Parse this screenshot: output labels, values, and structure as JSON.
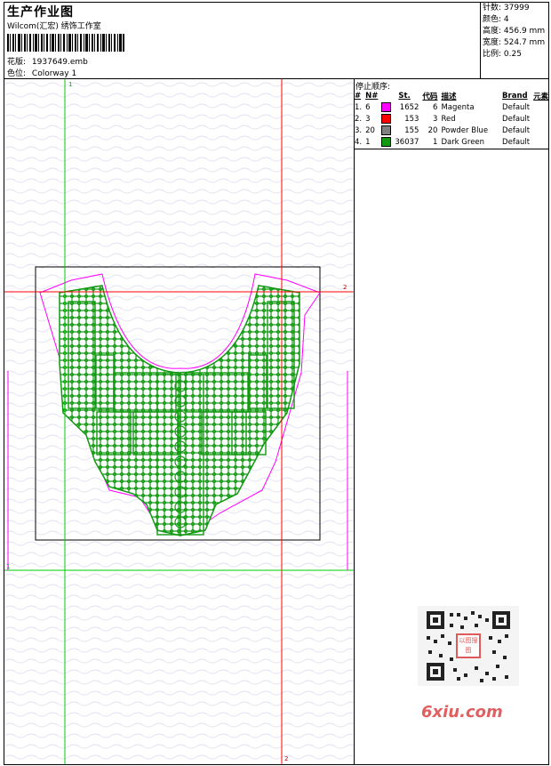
{
  "header": {
    "title": "生产作业图",
    "company": "Wilcom(汇宏) 绣饰工作室",
    "design_label": "花版:",
    "design_value": "1937649.emb",
    "colorway_label": "色位:",
    "colorway_value": "Colorway 1"
  },
  "stats": {
    "stitches_label": "针数:",
    "stitches_value": "37999",
    "colors_label": "颜色:",
    "colors_value": "4",
    "height_label": "高度:",
    "height_value": "456.9 mm",
    "width_label": "宽度:",
    "width_value": "524.7 mm",
    "scale_label": "比例:",
    "scale_value": "0.25"
  },
  "stop_sequence": {
    "title": "停止顺序:",
    "columns": [
      "#",
      "N#",
      "St.",
      "代码",
      "描述",
      "Brand",
      "元素"
    ],
    "rows": [
      {
        "index": "1.",
        "needle": "6",
        "color": "#ff00ff",
        "stitches": "1652",
        "code": "6",
        "desc": "Magenta",
        "brand": "Default"
      },
      {
        "index": "2.",
        "needle": "3",
        "color": "#ff0000",
        "stitches": "153",
        "code": "3",
        "desc": "Red",
        "brand": "Default"
      },
      {
        "index": "3.",
        "needle": "20",
        "color": "#808080",
        "stitches": "155",
        "code": "20",
        "desc": "Powder Blue",
        "brand": "Default"
      },
      {
        "index": "4.",
        "needle": "1",
        "color": "#119911",
        "stitches": "36037",
        "code": "1",
        "desc": "Dark Green",
        "brand": "Default"
      }
    ]
  },
  "guides": {
    "label_1_top": "1",
    "label_2_right": "2",
    "label_1_left": "1",
    "label_2_bottom": "2"
  },
  "watermark": {
    "site": "6xiu.com",
    "stamp_text": "以图搜图"
  },
  "colors": {
    "embroidery": "#119911",
    "outline": "#ff00ff",
    "guide_red": "#ff0000",
    "guide_green": "#00cc00"
  }
}
